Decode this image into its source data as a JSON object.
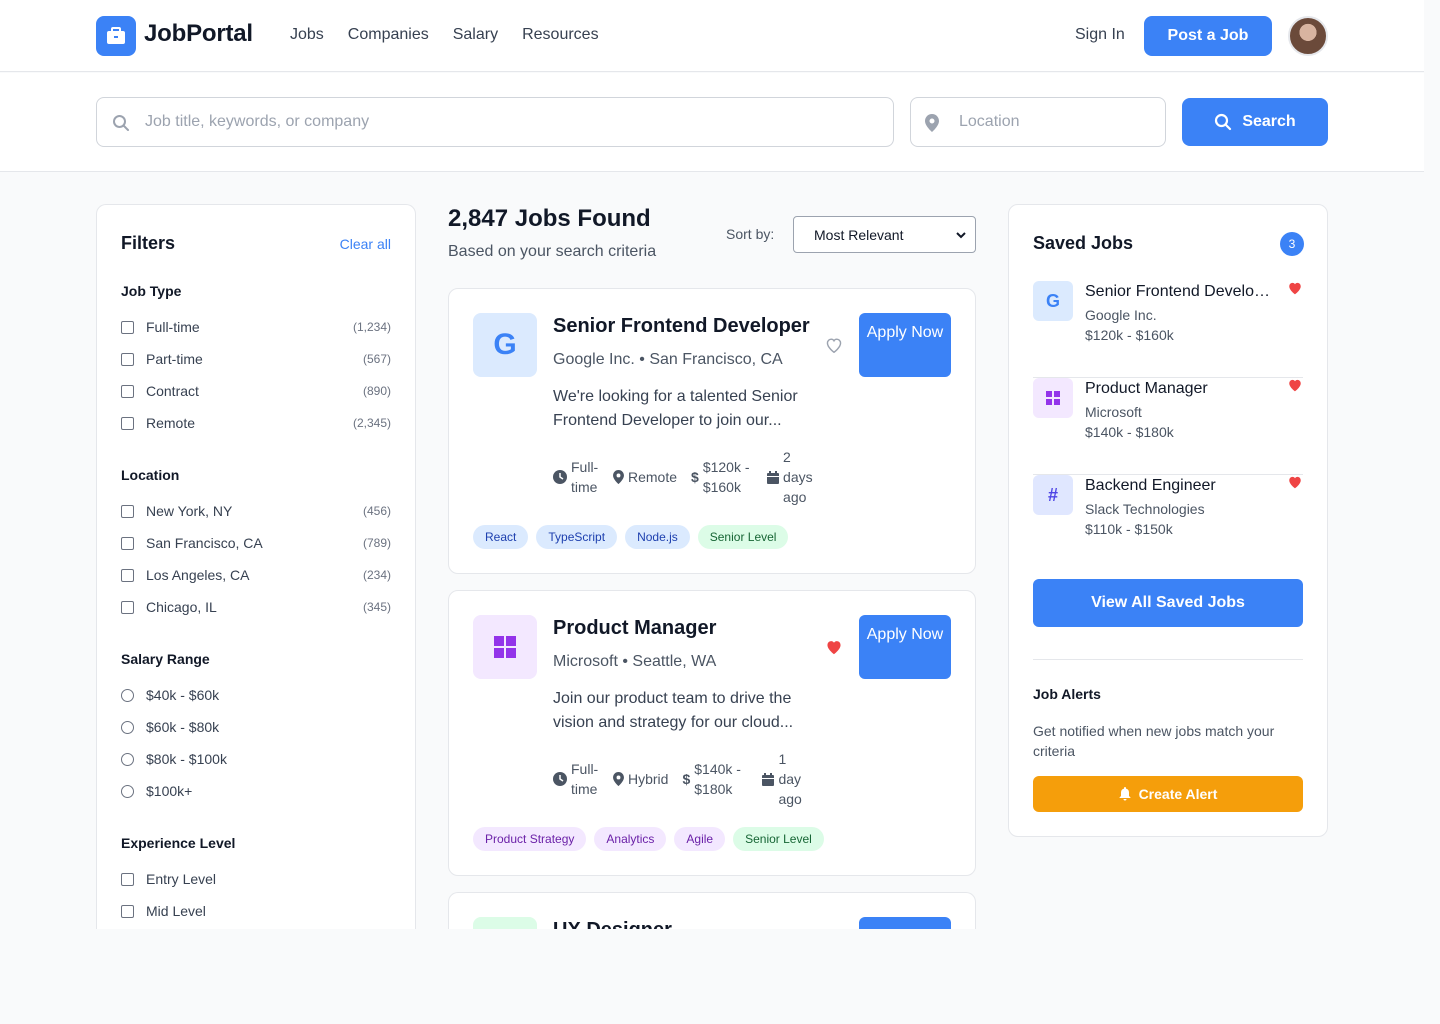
{
  "header": {
    "logo": "JobPortal",
    "nav": [
      "Jobs",
      "Companies",
      "Salary",
      "Resources"
    ],
    "sign_in": "Sign In",
    "post_job": "Post a Job"
  },
  "search": {
    "keyword_placeholder": "Job title, keywords, or company",
    "location_placeholder": "Location",
    "button": "Search"
  },
  "filters": {
    "title": "Filters",
    "clear_all": "Clear all",
    "job_type": {
      "title": "Job Type",
      "options": [
        {
          "label": "Full-time",
          "count": "(1,234)"
        },
        {
          "label": "Part-time",
          "count": "(567)"
        },
        {
          "label": "Contract",
          "count": "(890)"
        },
        {
          "label": "Remote",
          "count": "(2,345)"
        }
      ]
    },
    "location": {
      "title": "Location",
      "options": [
        {
          "label": "New York, NY",
          "count": "(456)"
        },
        {
          "label": "San Francisco, CA",
          "count": "(789)"
        },
        {
          "label": "Los Angeles, CA",
          "count": "(234)"
        },
        {
          "label": "Chicago, IL",
          "count": "(345)"
        }
      ]
    },
    "salary": {
      "title": "Salary Range",
      "options": [
        "$40k - $60k",
        "$60k - $80k",
        "$80k - $100k",
        "$100k+"
      ]
    },
    "experience": {
      "title": "Experience Level",
      "options": [
        "Entry Level",
        "Mid Level"
      ]
    }
  },
  "results": {
    "title": "2,847 Jobs Found",
    "subtitle": "Based on your search criteria",
    "sort_label": "Sort by:",
    "sort_value": "Most Relevant"
  },
  "jobs": [
    {
      "logo": "G",
      "title": "Senior Frontend Developer",
      "meta": "Google Inc. • San Francisco, CA",
      "desc": "We're looking for a talented Senior Frontend Developer to join our...",
      "apply": "Apply Now",
      "type": "Full-time",
      "workplace": "Remote",
      "salary": "$120k - $160k",
      "posted": "2 days ago",
      "saved": false,
      "tags": [
        "React",
        "TypeScript",
        "Node.js",
        "Senior Level"
      ]
    },
    {
      "title": "Product Manager",
      "meta": "Microsoft • Seattle, WA",
      "desc": "Join our product team to drive the vision and strategy for our cloud...",
      "apply": "Apply Now",
      "type": "Full-time",
      "workplace": "Hybrid",
      "salary": "$140k - $180k",
      "posted": "1 day ago",
      "saved": true,
      "tags": [
        "Product Strategy",
        "Analytics",
        "Agile",
        "Senior Level"
      ]
    },
    {
      "title": "UX Designer"
    }
  ],
  "saved_jobs": {
    "title": "Saved Jobs",
    "count": "3",
    "items": [
      {
        "logo": "G",
        "title": "Senior Frontend Developer",
        "company": "Google Inc.",
        "salary": "$120k - $160k"
      },
      {
        "title": "Product Manager",
        "company": "Microsoft",
        "salary": "$140k - $180k"
      },
      {
        "title": "Backend Engineer",
        "company": "Slack Technologies",
        "salary": "$110k - $150k"
      }
    ],
    "view_all": "View All Saved Jobs"
  },
  "alerts": {
    "title": "Job Alerts",
    "desc": "Get notified when new jobs match your criteria",
    "button": "Create Alert"
  },
  "colors": {
    "primary": "#3b82f6",
    "heart": "#ef4444",
    "alert": "#f59e0b",
    "microsoft": "#9333ea"
  }
}
